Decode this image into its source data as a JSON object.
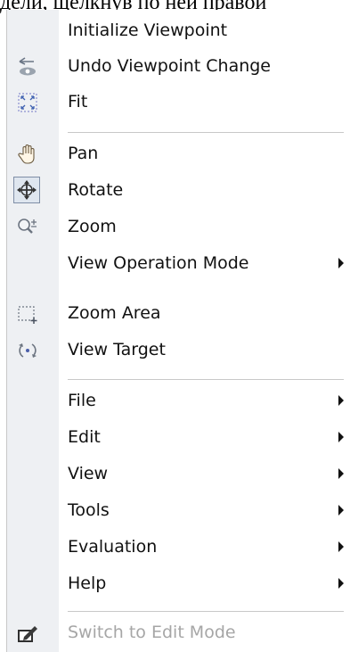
{
  "caption": "дели, щелкнув по ней правой",
  "menu": {
    "items": [
      {
        "label": "Initialize Viewpoint",
        "icon": null,
        "enabled": true,
        "submenu": false
      },
      {
        "label": "Undo Viewpoint Change",
        "icon": "undo-viewpoint-icon",
        "enabled": true,
        "submenu": false
      },
      {
        "label": "Fit",
        "icon": "fit-icon",
        "enabled": true,
        "submenu": false
      },
      {
        "label": "Pan",
        "icon": "hand-icon",
        "enabled": true,
        "submenu": false
      },
      {
        "label": "Rotate",
        "icon": "rotate-icon",
        "enabled": true,
        "submenu": false,
        "checked": true
      },
      {
        "label": "Zoom",
        "icon": "zoom-icon",
        "enabled": true,
        "submenu": false
      },
      {
        "label": "View Operation Mode",
        "icon": null,
        "enabled": true,
        "submenu": true
      },
      {
        "label": "Zoom Area",
        "icon": "zoom-area-icon",
        "enabled": true,
        "submenu": false
      },
      {
        "label": "View Target",
        "icon": "view-target-icon",
        "enabled": true,
        "submenu": false
      },
      {
        "label": "File",
        "icon": null,
        "enabled": true,
        "submenu": true
      },
      {
        "label": "Edit",
        "icon": null,
        "enabled": true,
        "submenu": true
      },
      {
        "label": "View",
        "icon": null,
        "enabled": true,
        "submenu": true
      },
      {
        "label": "Tools",
        "icon": null,
        "enabled": true,
        "submenu": true
      },
      {
        "label": "Evaluation",
        "icon": null,
        "enabled": true,
        "submenu": true
      },
      {
        "label": "Help",
        "icon": null,
        "enabled": true,
        "submenu": true
      },
      {
        "label": "Switch to Edit Mode",
        "icon": "edit-mode-icon",
        "enabled": false,
        "submenu": false
      }
    ]
  }
}
